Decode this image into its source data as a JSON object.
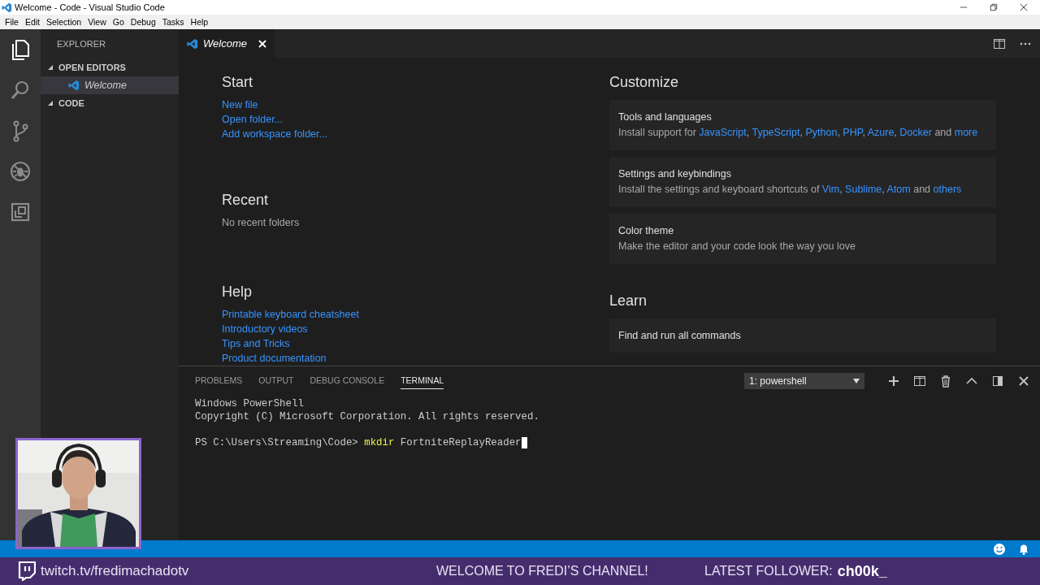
{
  "window": {
    "title": "Welcome - Code - Visual Studio Code"
  },
  "menu": [
    "File",
    "Edit",
    "Selection",
    "View",
    "Go",
    "Debug",
    "Tasks",
    "Help"
  ],
  "activity_bar": [
    {
      "kind": "files",
      "selected": true
    },
    {
      "kind": "search",
      "selected": false
    },
    {
      "kind": "git",
      "selected": false
    },
    {
      "kind": "debug",
      "selected": false
    },
    {
      "kind": "extensions",
      "selected": false
    }
  ],
  "sidebar": {
    "title": "EXPLORER",
    "sections": [
      {
        "label": "OPEN EDITORS",
        "expanded": true,
        "items": [
          {
            "label": "Welcome",
            "selected": true
          }
        ]
      },
      {
        "label": "CODE",
        "expanded": true
      }
    ]
  },
  "tabs": [
    {
      "label": "Welcome",
      "selected": true
    }
  ],
  "welcome": {
    "left": [
      {
        "heading": "Start",
        "links": [
          "New file",
          "Open folder...",
          "Add workspace folder..."
        ]
      },
      {
        "heading": "Recent",
        "note": "No recent folders"
      },
      {
        "heading": "Help",
        "links": [
          "Printable keyboard cheatsheet",
          "Introductory videos",
          "Tips and Tricks",
          "Product documentation"
        ]
      }
    ],
    "right": [
      {
        "heading": "Customize",
        "cards": [
          {
            "title": "Tools and languages",
            "description": [
              {
                "text": "Install support for ",
                "link": false
              },
              {
                "text": "JavaScript",
                "link": true
              },
              {
                "text": ", ",
                "link": false
              },
              {
                "text": "TypeScript",
                "link": true
              },
              {
                "text": ", ",
                "link": false
              },
              {
                "text": "Python",
                "link": true
              },
              {
                "text": ", ",
                "link": false
              },
              {
                "text": "PHP",
                "link": true
              },
              {
                "text": ", ",
                "link": false
              },
              {
                "text": "Azure",
                "link": true
              },
              {
                "text": ", ",
                "link": false
              },
              {
                "text": "Docker",
                "link": true
              },
              {
                "text": " and ",
                "link": false
              },
              {
                "text": "more",
                "link": true
              }
            ]
          },
          {
            "title": "Settings and keybindings",
            "description": [
              {
                "text": "Install the settings and keyboard shortcuts of ",
                "link": false
              },
              {
                "text": "Vim",
                "link": true
              },
              {
                "text": ", ",
                "link": false
              },
              {
                "text": "Sublime",
                "link": true
              },
              {
                "text": ", ",
                "link": false
              },
              {
                "text": "Atom",
                "link": true
              },
              {
                "text": " and ",
                "link": false
              },
              {
                "text": "others",
                "link": true
              }
            ]
          },
          {
            "title": "Color theme",
            "description": [
              {
                "text": "Make the editor and your code look the way you love",
                "link": false
              }
            ]
          }
        ]
      },
      {
        "heading": "Learn",
        "cards": [
          {
            "title": "Find and run all commands"
          }
        ]
      }
    ]
  },
  "panel": {
    "tabs": [
      {
        "label": "PROBLEMS",
        "selected": false
      },
      {
        "label": "OUTPUT",
        "selected": false
      },
      {
        "label": "DEBUG CONSOLE",
        "selected": false
      },
      {
        "label": "TERMINAL",
        "selected": true
      }
    ],
    "terminal_select": "1: powershell",
    "lines": [
      {
        "kind": "output",
        "text": "Windows PowerShell"
      },
      {
        "kind": "output",
        "text": "Copyright (C) Microsoft Corporation. All rights reserved."
      },
      {
        "kind": "blank"
      },
      {
        "kind": "prompt",
        "prompt": "PS C:\\Users\\Streaming\\Code> ",
        "command": "mkdir",
        "argument": " FortniteReplayReader"
      }
    ]
  },
  "stream": {
    "channel": "twitch.tv/fredimachadotv",
    "message": "WELCOME TO FREDI’S CHANNEL!",
    "follower_label": "LATEST FOLLOWER:",
    "follower": "ch00k_"
  }
}
